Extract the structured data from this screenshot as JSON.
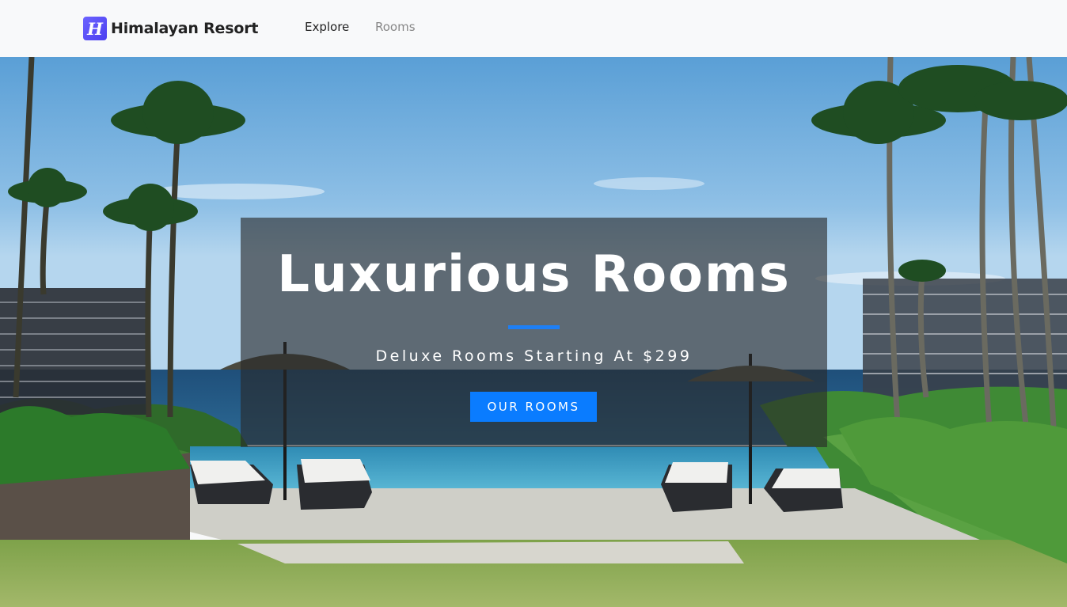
{
  "navbar": {
    "brand_name": "Himalayan Resort",
    "logo_letter": "H",
    "links": [
      {
        "label": "Explore"
      },
      {
        "label": "Rooms"
      }
    ]
  },
  "hero": {
    "title": "Luxurious Rooms",
    "subtitle": "Deluxe Rooms Starting At $299",
    "button_label": "OUR ROOMS"
  },
  "colors": {
    "accent": "#0a7cff",
    "underline": "#1e7ff5",
    "logo": "#5b50f5",
    "navbar_bg": "#f8f9fa"
  },
  "icons": [
    "logo-h-icon"
  ]
}
